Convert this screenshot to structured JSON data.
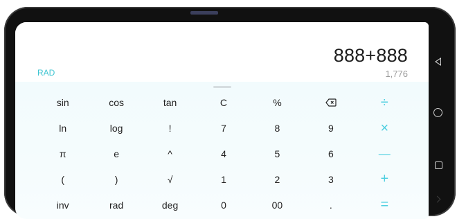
{
  "display": {
    "expression": "888+888",
    "result": "1,776",
    "angle_mode": "RAD"
  },
  "keypad": {
    "rows": [
      [
        "sin",
        "cos",
        "tan",
        "C",
        "%",
        "backspace",
        "÷"
      ],
      [
        "ln",
        "log",
        "!",
        "7",
        "8",
        "9",
        "×"
      ],
      [
        "π",
        "e",
        "^",
        "4",
        "5",
        "6",
        "—"
      ],
      [
        "(",
        ")",
        "√",
        "1",
        "2",
        "3",
        "+"
      ],
      [
        "inv",
        "rad",
        "deg",
        "0",
        "00",
        ".",
        "="
      ]
    ]
  },
  "colors": {
    "accent": "#4fcfe0",
    "mode_label": "#3fc5d2",
    "keypad_bg": "#f2fbfd",
    "result_text": "#9a9a9a"
  },
  "icons": {
    "backspace": "backspace-icon",
    "nav_back": "nav-back-icon",
    "nav_home": "nav-home-icon",
    "nav_recent": "nav-recent-icon"
  }
}
